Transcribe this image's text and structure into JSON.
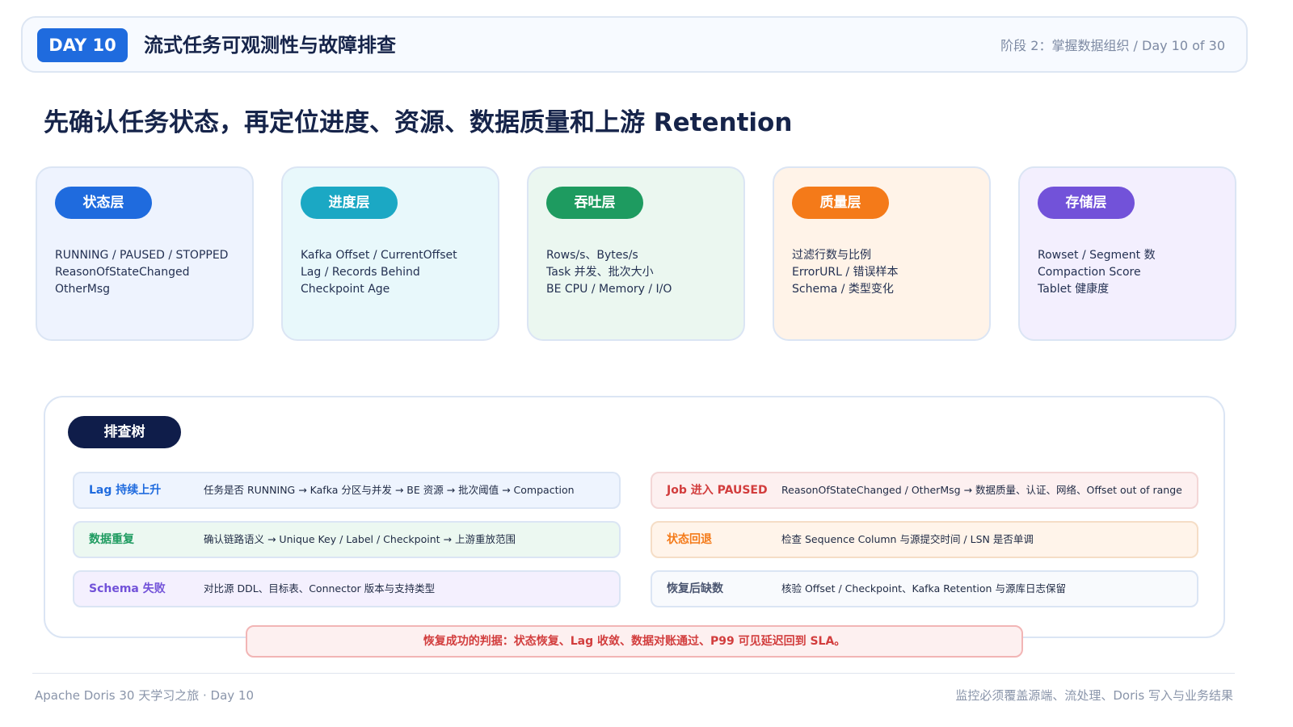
{
  "header": {
    "day_badge": "DAY 10",
    "title": "流式任务可观测性与故障排查",
    "meta": "阶段 2：掌握数据组织  /  Day 10 of 30"
  },
  "main_title": "先确认任务状态，再定位进度、资源、数据质量和上游 Retention",
  "layers": [
    {
      "label": "状态层",
      "lines": [
        "RUNNING / PAUSED / STOPPED",
        "ReasonOfStateChanged",
        "OtherMsg"
      ]
    },
    {
      "label": "进度层",
      "lines": [
        "Kafka Offset / CurrentOffset",
        "Lag / Records Behind",
        "Checkpoint Age"
      ]
    },
    {
      "label": "吞吐层",
      "lines": [
        "Rows/s、Bytes/s",
        "Task 并发、批次大小",
        "BE CPU / Memory / I/O"
      ]
    },
    {
      "label": "质量层",
      "lines": [
        "过滤行数与比例",
        "ErrorURL / 错误样本",
        "Schema / 类型变化"
      ]
    },
    {
      "label": "存储层",
      "lines": [
        "Rowset / Segment 数",
        "Compaction Score",
        "Tablet 健康度"
      ]
    }
  ],
  "colors": {
    "status": "#1f6bde",
    "progress": "#1ba8c4",
    "throughput": "#1e9b60",
    "quality": "#f47a19",
    "storage": "#7252d9"
  },
  "tree": {
    "badge": "排查树",
    "rows": [
      {
        "label": "Lag 持续上升",
        "desc": "任务是否 RUNNING → Kafka 分区与并发 → BE 资源 → 批次阈值 → Compaction"
      },
      {
        "label": "Job 进入 PAUSED",
        "desc": "ReasonOfStateChanged / OtherMsg → 数据质量、认证、网络、Offset out of range"
      },
      {
        "label": "数据重复",
        "desc": "确认链路语义 → Unique Key / Label / Checkpoint → 上游重放范围"
      },
      {
        "label": "状态回退",
        "desc": "检查 Sequence Column 与源提交时间 / LSN 是否单调"
      },
      {
        "label": "Schema 失败",
        "desc": "对比源 DDL、目标表、Connector 版本与支持类型"
      },
      {
        "label": "恢复后缺数",
        "desc": "核验 Offset / Checkpoint、Kafka Retention 与源库日志保留"
      }
    ]
  },
  "banner": "恢复成功的判据：状态恢复、Lag 收敛、数据对账通过、P99 可见延迟回到 SLA。",
  "footer": {
    "left": "Apache Doris 30 天学习之旅 · Day 10",
    "right": "监控必须覆盖源端、流处理、Doris 写入与业务结果"
  }
}
